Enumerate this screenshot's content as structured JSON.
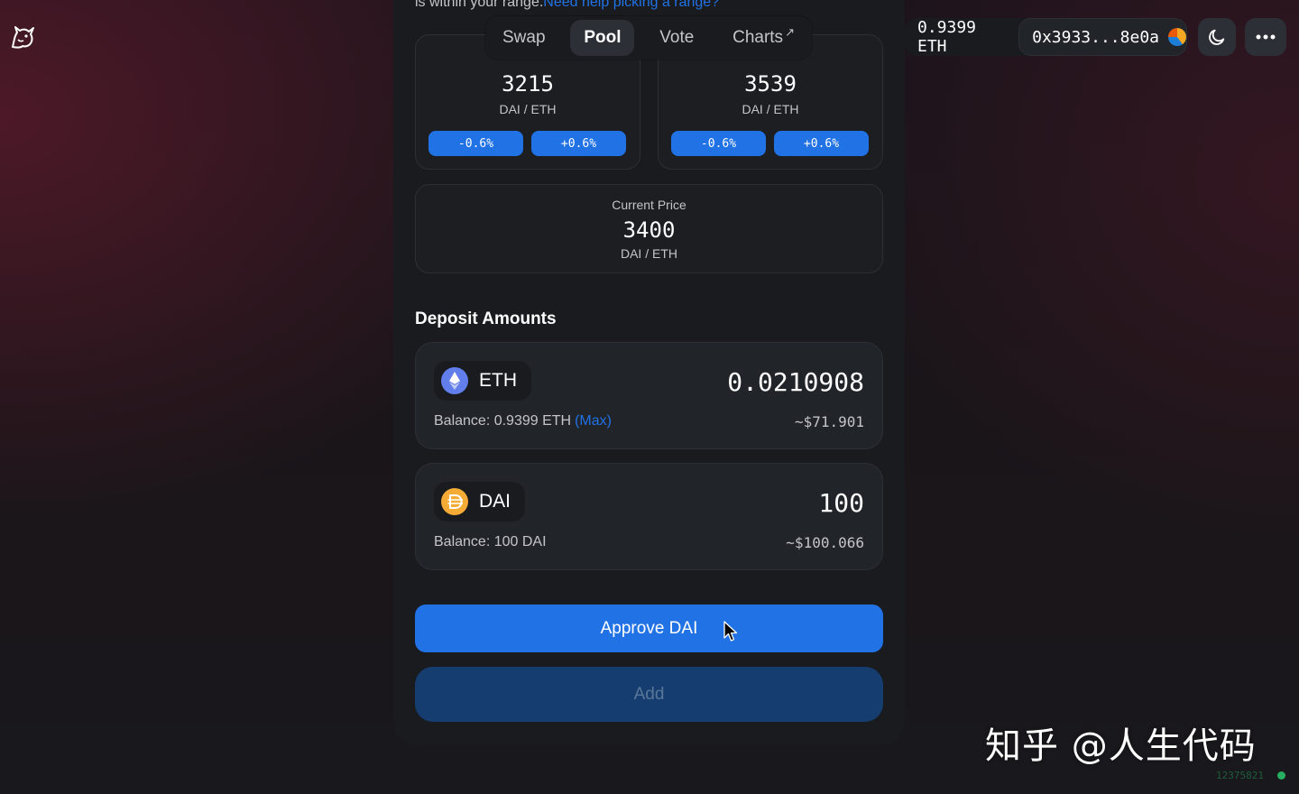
{
  "nav": {
    "tabs": [
      {
        "label": "Swap",
        "active": false
      },
      {
        "label": "Pool",
        "active": true
      },
      {
        "label": "Vote",
        "active": false
      },
      {
        "label": "Charts",
        "active": false,
        "external_mark": "↗"
      }
    ]
  },
  "account": {
    "balance": "0.9399 ETH",
    "address": "0x3933...8e0a"
  },
  "range": {
    "hint_text": "is within your range.",
    "hint_link": "Need help picking a range?",
    "min": {
      "value": "3215",
      "unit": "DAI / ETH",
      "decrease": "-0.6%",
      "increase": "+0.6%"
    },
    "max": {
      "value": "3539",
      "unit": "DAI / ETH",
      "decrease": "-0.6%",
      "increase": "+0.6%"
    }
  },
  "current_price": {
    "label": "Current Price",
    "value": "3400",
    "unit": "DAI / ETH"
  },
  "deposit": {
    "title": "Deposit Amounts",
    "eth": {
      "symbol": "ETH",
      "amount": "0.0210908",
      "balance_label": "Balance: 0.9399 ETH",
      "max_label": "(Max)",
      "usd": "~$71.901"
    },
    "dai": {
      "symbol": "DAI",
      "amount": "100",
      "balance_label": "Balance: 100 DAI",
      "usd": "~$100.066"
    }
  },
  "buttons": {
    "approve": "Approve DAI",
    "add": "Add"
  },
  "watermark": "知乎 @人生代码",
  "block_number": "12375821",
  "colors": {
    "accent": "#2172e5",
    "card": "#191b1f",
    "status_green": "#27ae60"
  },
  "icons": [
    "unicorn-logo-icon",
    "moon-icon",
    "more-dots-icon",
    "eth-token-icon",
    "dai-token-icon",
    "cursor-icon"
  ]
}
